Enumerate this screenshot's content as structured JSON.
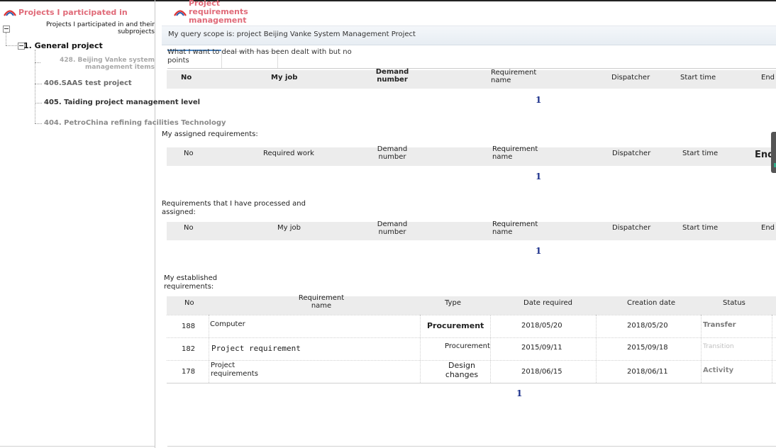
{
  "left_panel": {
    "title": "Projects I participated in",
    "root_label": "Projects I participated in and their subprojects",
    "nodes": [
      {
        "label": "1. General project"
      },
      {
        "label": "428. Beijing Vanke system management items"
      },
      {
        "label": "406.SAAS test project"
      },
      {
        "label": "405. Taiding project management level"
      },
      {
        "label": "404. PetroChina refining facilities Technology"
      }
    ]
  },
  "right_panel": {
    "title": "Project requirements management",
    "scope_text": "My query scope is: project Beijing Vanke System Management Project",
    "tab_label": "What I want to deal with has been dealt with but no points",
    "section1": {
      "headers": {
        "no": "No",
        "work": "My job",
        "demand": "Demand number",
        "req": "Requirement name",
        "dispatcher": "Dispatcher",
        "start": "Start time",
        "end": "End"
      },
      "page": "1"
    },
    "section2": {
      "title": "My assigned requirements:",
      "headers": {
        "no": "No",
        "work": "Required work",
        "demand": "Demand number",
        "req": "Requirement name",
        "dispatcher": "Dispatcher",
        "start": "Start time",
        "end": "End"
      },
      "page": "1"
    },
    "section3": {
      "title": "Requirements that I have processed and assigned:",
      "headers": {
        "no": "No",
        "work": "My job",
        "demand": "Demand number",
        "req": "Requirement name",
        "dispatcher": "Dispatcher",
        "start": "Start time",
        "end": "End"
      },
      "page": "1"
    },
    "section4": {
      "title": "My established requirements:",
      "headers": {
        "no": "No",
        "req": "Requirement name",
        "type": "Type",
        "date_required": "Date required",
        "created": "Creation date",
        "status": "Status"
      },
      "rows": [
        {
          "no": "188",
          "name": "Computer",
          "type": "Procurement",
          "date_required": "2018/05/20",
          "created": "2018/05/20",
          "status": "Transfer"
        },
        {
          "no": "182",
          "name": "Project requirement",
          "type": "Procurement",
          "date_required": "2015/09/11",
          "created": "2015/09/18",
          "status": "Transition"
        },
        {
          "no": "178",
          "name": "Project requirements",
          "type": "Design changes",
          "date_required": "2018/06/15",
          "created": "2018/06/11",
          "status": "Activity"
        }
      ],
      "page": "1"
    }
  },
  "colors": {
    "title_accent": "#e06a78",
    "pager": "#1a2f8a",
    "header_bg": "#ececec"
  },
  "icons": {
    "logo": "company-logo-icon"
  }
}
